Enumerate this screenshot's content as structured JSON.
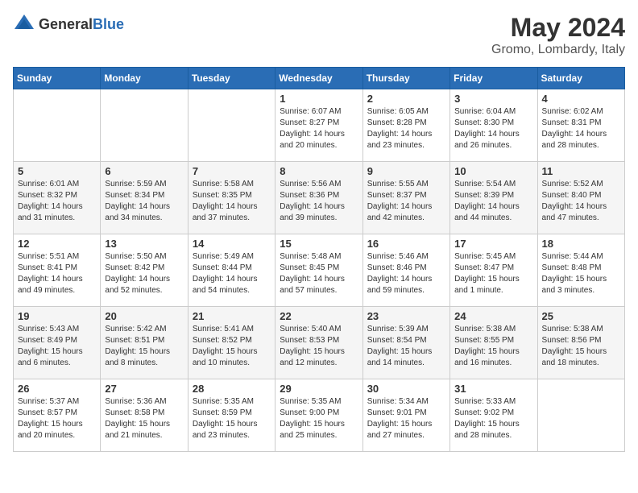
{
  "header": {
    "logo_general": "General",
    "logo_blue": "Blue",
    "month": "May 2024",
    "location": "Gromo, Lombardy, Italy"
  },
  "days_of_week": [
    "Sunday",
    "Monday",
    "Tuesday",
    "Wednesday",
    "Thursday",
    "Friday",
    "Saturday"
  ],
  "weeks": [
    [
      {
        "day": "",
        "content": ""
      },
      {
        "day": "",
        "content": ""
      },
      {
        "day": "",
        "content": ""
      },
      {
        "day": "1",
        "content": "Sunrise: 6:07 AM\nSunset: 8:27 PM\nDaylight: 14 hours\nand 20 minutes."
      },
      {
        "day": "2",
        "content": "Sunrise: 6:05 AM\nSunset: 8:28 PM\nDaylight: 14 hours\nand 23 minutes."
      },
      {
        "day": "3",
        "content": "Sunrise: 6:04 AM\nSunset: 8:30 PM\nDaylight: 14 hours\nand 26 minutes."
      },
      {
        "day": "4",
        "content": "Sunrise: 6:02 AM\nSunset: 8:31 PM\nDaylight: 14 hours\nand 28 minutes."
      }
    ],
    [
      {
        "day": "5",
        "content": "Sunrise: 6:01 AM\nSunset: 8:32 PM\nDaylight: 14 hours\nand 31 minutes."
      },
      {
        "day": "6",
        "content": "Sunrise: 5:59 AM\nSunset: 8:34 PM\nDaylight: 14 hours\nand 34 minutes."
      },
      {
        "day": "7",
        "content": "Sunrise: 5:58 AM\nSunset: 8:35 PM\nDaylight: 14 hours\nand 37 minutes."
      },
      {
        "day": "8",
        "content": "Sunrise: 5:56 AM\nSunset: 8:36 PM\nDaylight: 14 hours\nand 39 minutes."
      },
      {
        "day": "9",
        "content": "Sunrise: 5:55 AM\nSunset: 8:37 PM\nDaylight: 14 hours\nand 42 minutes."
      },
      {
        "day": "10",
        "content": "Sunrise: 5:54 AM\nSunset: 8:39 PM\nDaylight: 14 hours\nand 44 minutes."
      },
      {
        "day": "11",
        "content": "Sunrise: 5:52 AM\nSunset: 8:40 PM\nDaylight: 14 hours\nand 47 minutes."
      }
    ],
    [
      {
        "day": "12",
        "content": "Sunrise: 5:51 AM\nSunset: 8:41 PM\nDaylight: 14 hours\nand 49 minutes."
      },
      {
        "day": "13",
        "content": "Sunrise: 5:50 AM\nSunset: 8:42 PM\nDaylight: 14 hours\nand 52 minutes."
      },
      {
        "day": "14",
        "content": "Sunrise: 5:49 AM\nSunset: 8:44 PM\nDaylight: 14 hours\nand 54 minutes."
      },
      {
        "day": "15",
        "content": "Sunrise: 5:48 AM\nSunset: 8:45 PM\nDaylight: 14 hours\nand 57 minutes."
      },
      {
        "day": "16",
        "content": "Sunrise: 5:46 AM\nSunset: 8:46 PM\nDaylight: 14 hours\nand 59 minutes."
      },
      {
        "day": "17",
        "content": "Sunrise: 5:45 AM\nSunset: 8:47 PM\nDaylight: 15 hours\nand 1 minute."
      },
      {
        "day": "18",
        "content": "Sunrise: 5:44 AM\nSunset: 8:48 PM\nDaylight: 15 hours\nand 3 minutes."
      }
    ],
    [
      {
        "day": "19",
        "content": "Sunrise: 5:43 AM\nSunset: 8:49 PM\nDaylight: 15 hours\nand 6 minutes."
      },
      {
        "day": "20",
        "content": "Sunrise: 5:42 AM\nSunset: 8:51 PM\nDaylight: 15 hours\nand 8 minutes."
      },
      {
        "day": "21",
        "content": "Sunrise: 5:41 AM\nSunset: 8:52 PM\nDaylight: 15 hours\nand 10 minutes."
      },
      {
        "day": "22",
        "content": "Sunrise: 5:40 AM\nSunset: 8:53 PM\nDaylight: 15 hours\nand 12 minutes."
      },
      {
        "day": "23",
        "content": "Sunrise: 5:39 AM\nSunset: 8:54 PM\nDaylight: 15 hours\nand 14 minutes."
      },
      {
        "day": "24",
        "content": "Sunrise: 5:38 AM\nSunset: 8:55 PM\nDaylight: 15 hours\nand 16 minutes."
      },
      {
        "day": "25",
        "content": "Sunrise: 5:38 AM\nSunset: 8:56 PM\nDaylight: 15 hours\nand 18 minutes."
      }
    ],
    [
      {
        "day": "26",
        "content": "Sunrise: 5:37 AM\nSunset: 8:57 PM\nDaylight: 15 hours\nand 20 minutes."
      },
      {
        "day": "27",
        "content": "Sunrise: 5:36 AM\nSunset: 8:58 PM\nDaylight: 15 hours\nand 21 minutes."
      },
      {
        "day": "28",
        "content": "Sunrise: 5:35 AM\nSunset: 8:59 PM\nDaylight: 15 hours\nand 23 minutes."
      },
      {
        "day": "29",
        "content": "Sunrise: 5:35 AM\nSunset: 9:00 PM\nDaylight: 15 hours\nand 25 minutes."
      },
      {
        "day": "30",
        "content": "Sunrise: 5:34 AM\nSunset: 9:01 PM\nDaylight: 15 hours\nand 27 minutes."
      },
      {
        "day": "31",
        "content": "Sunrise: 5:33 AM\nSunset: 9:02 PM\nDaylight: 15 hours\nand 28 minutes."
      },
      {
        "day": "",
        "content": ""
      }
    ]
  ]
}
